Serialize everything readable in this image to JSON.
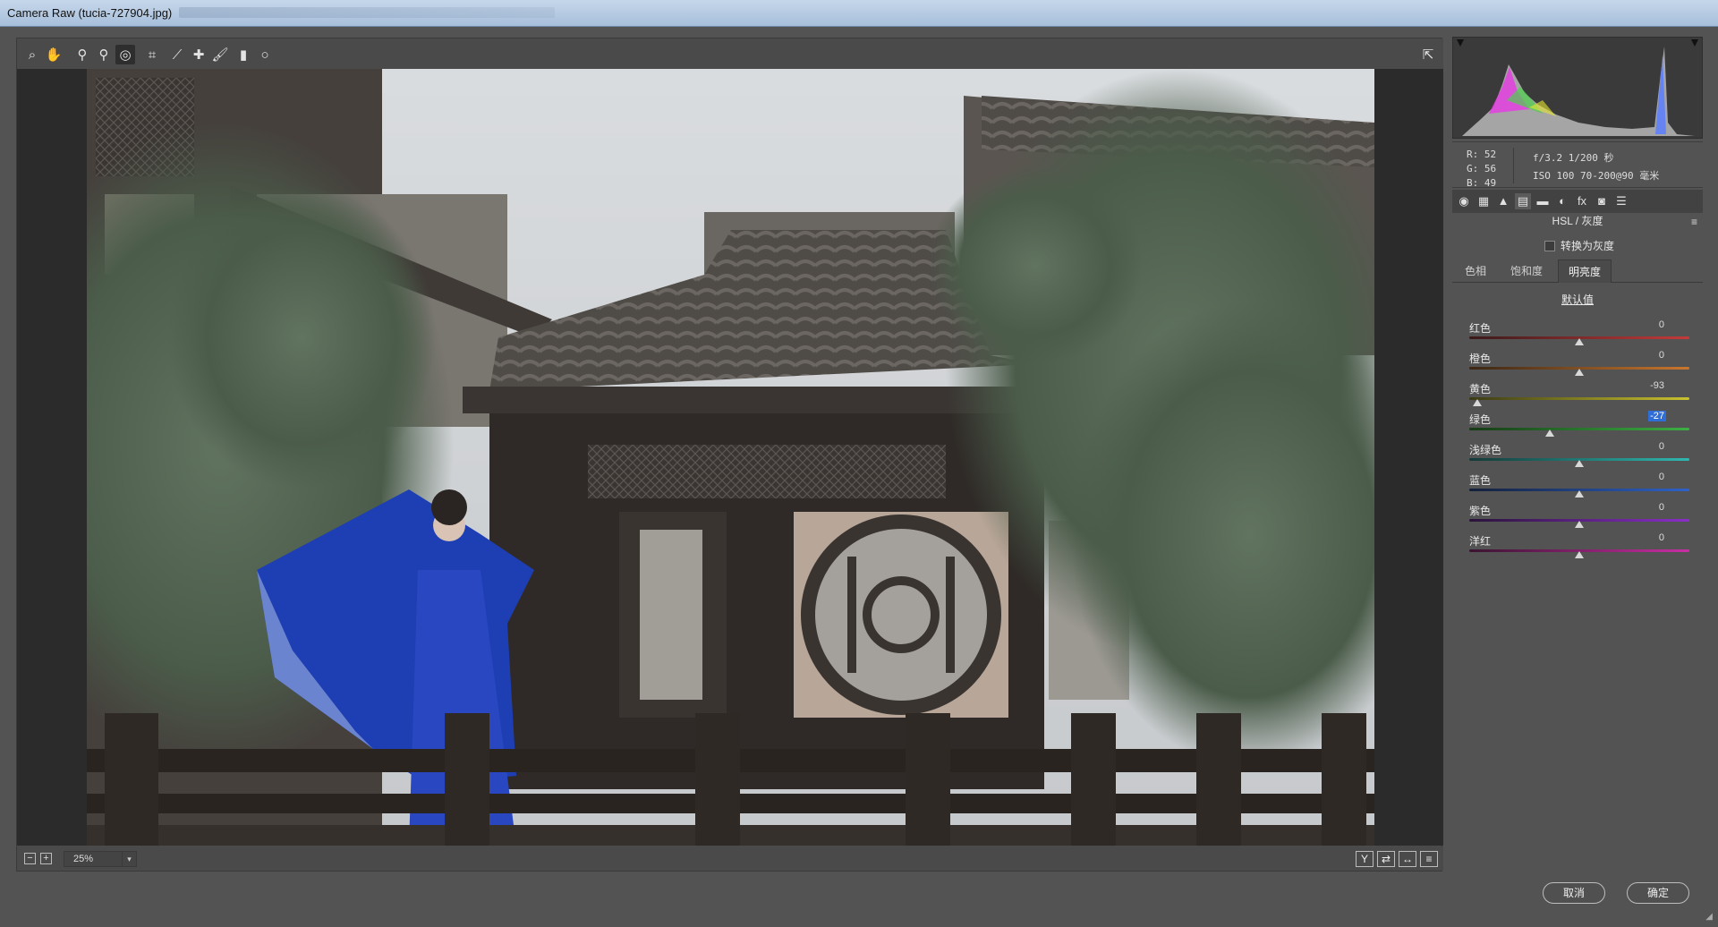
{
  "window": {
    "title": "Camera Raw (tucia-727904.jpg)"
  },
  "toolbar": {
    "tools": [
      {
        "name": "zoom-tool",
        "glyph": "⌕"
      },
      {
        "name": "hand-tool",
        "glyph": "✋"
      },
      {
        "name": "white-balance-tool",
        "glyph": "⚲"
      },
      {
        "name": "color-sampler-tool",
        "glyph": "⚲"
      },
      {
        "name": "targeted-adjustment-tool",
        "glyph": "◎"
      },
      {
        "name": "crop-tool",
        "glyph": "⌗"
      },
      {
        "name": "straighten-tool",
        "glyph": "⟋"
      },
      {
        "name": "spot-removal-tool",
        "glyph": "✚"
      },
      {
        "name": "adjustment-brush-tool",
        "glyph": "🖌"
      },
      {
        "name": "graduated-filter-tool",
        "glyph": "▮"
      },
      {
        "name": "radial-filter-tool",
        "glyph": "○"
      }
    ],
    "active_tool": "targeted-adjustment-tool",
    "fullscreen_glyph": "⇱"
  },
  "statusbar": {
    "zoom_out_glyph": "−",
    "zoom_in_glyph": "+",
    "zoom_value": "25%",
    "zoom_caret": "▾",
    "view_buttons": [
      "Y",
      "⇄",
      "↔",
      "≡"
    ]
  },
  "info": {
    "r": "R:  52",
    "g": "G:  56",
    "b": "B:  49",
    "exposure": "f/3.2  1/200 秒",
    "iso_lens": "ISO 100  70-200@90 毫米"
  },
  "panel_tabs": [
    "◉",
    "▦",
    "▲",
    "▤",
    "▬",
    "◐",
    "fx",
    "◙",
    "☰"
  ],
  "panel": {
    "section_title": "HSL / 灰度",
    "menu_glyph": "≡",
    "grayscale_label": "转换为灰度",
    "subtabs": [
      "色相",
      "饱和度",
      "明亮度"
    ],
    "active_subtab": "明亮度",
    "defaults_label": "默认值",
    "sliders": [
      {
        "label": "红色",
        "value": "0",
        "level": 0,
        "track": "linear-gradient(90deg,#3a1a1a,#c43a3a)",
        "selected": false
      },
      {
        "label": "橙色",
        "value": "0",
        "level": 0,
        "track": "linear-gradient(90deg,#3a2614,#c9762e)",
        "selected": false
      },
      {
        "label": "黄色",
        "value": "-93",
        "level": -93,
        "track": "linear-gradient(90deg,#3a3a14,#c9c22e)",
        "selected": false
      },
      {
        "label": "绿色",
        "value": "-27",
        "level": -27,
        "track": "linear-gradient(90deg,#163a16,#3cb043)",
        "selected": true
      },
      {
        "label": "浅绿色",
        "value": "0",
        "level": 0,
        "track": "linear-gradient(90deg,#143a38,#2eb8b0)",
        "selected": false
      },
      {
        "label": "蓝色",
        "value": "0",
        "level": 0,
        "track": "linear-gradient(90deg,#14203a,#2e62c9)",
        "selected": false
      },
      {
        "label": "紫色",
        "value": "0",
        "level": 0,
        "track": "linear-gradient(90deg,#2a143a,#8a2ec9)",
        "selected": false
      },
      {
        "label": "洋红",
        "value": "0",
        "level": 0,
        "track": "linear-gradient(90deg,#3a1430,#c92ea4)",
        "selected": false
      }
    ]
  },
  "buttons": {
    "cancel": "取消",
    "ok": "确定"
  }
}
